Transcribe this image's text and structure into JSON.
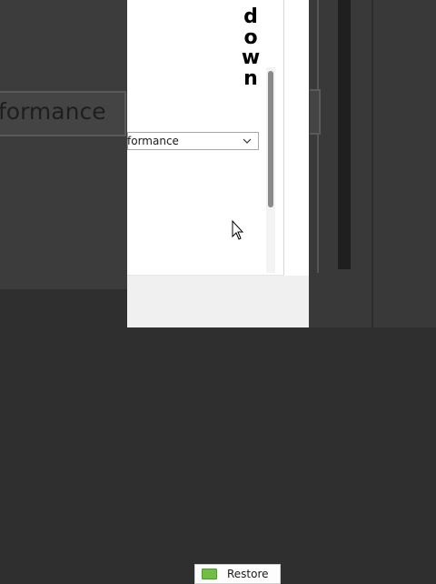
{
  "background": {
    "left_ghost_text": "formance"
  },
  "settings": {
    "mode_value": "formance",
    "mode_chevron_icon": "chevron-down-icon"
  },
  "footer": {
    "restore_label": "Restore",
    "restore_icon": "green-restore-icon"
  },
  "overlay_caption": {
    "letters": [
      "d",
      "o",
      "w",
      "n"
    ]
  },
  "colors": {
    "panel": "#ffffff",
    "footer": "#f0f0f0",
    "restore_icon": "#6fbf44",
    "backdrop": "#3a3a3a"
  }
}
